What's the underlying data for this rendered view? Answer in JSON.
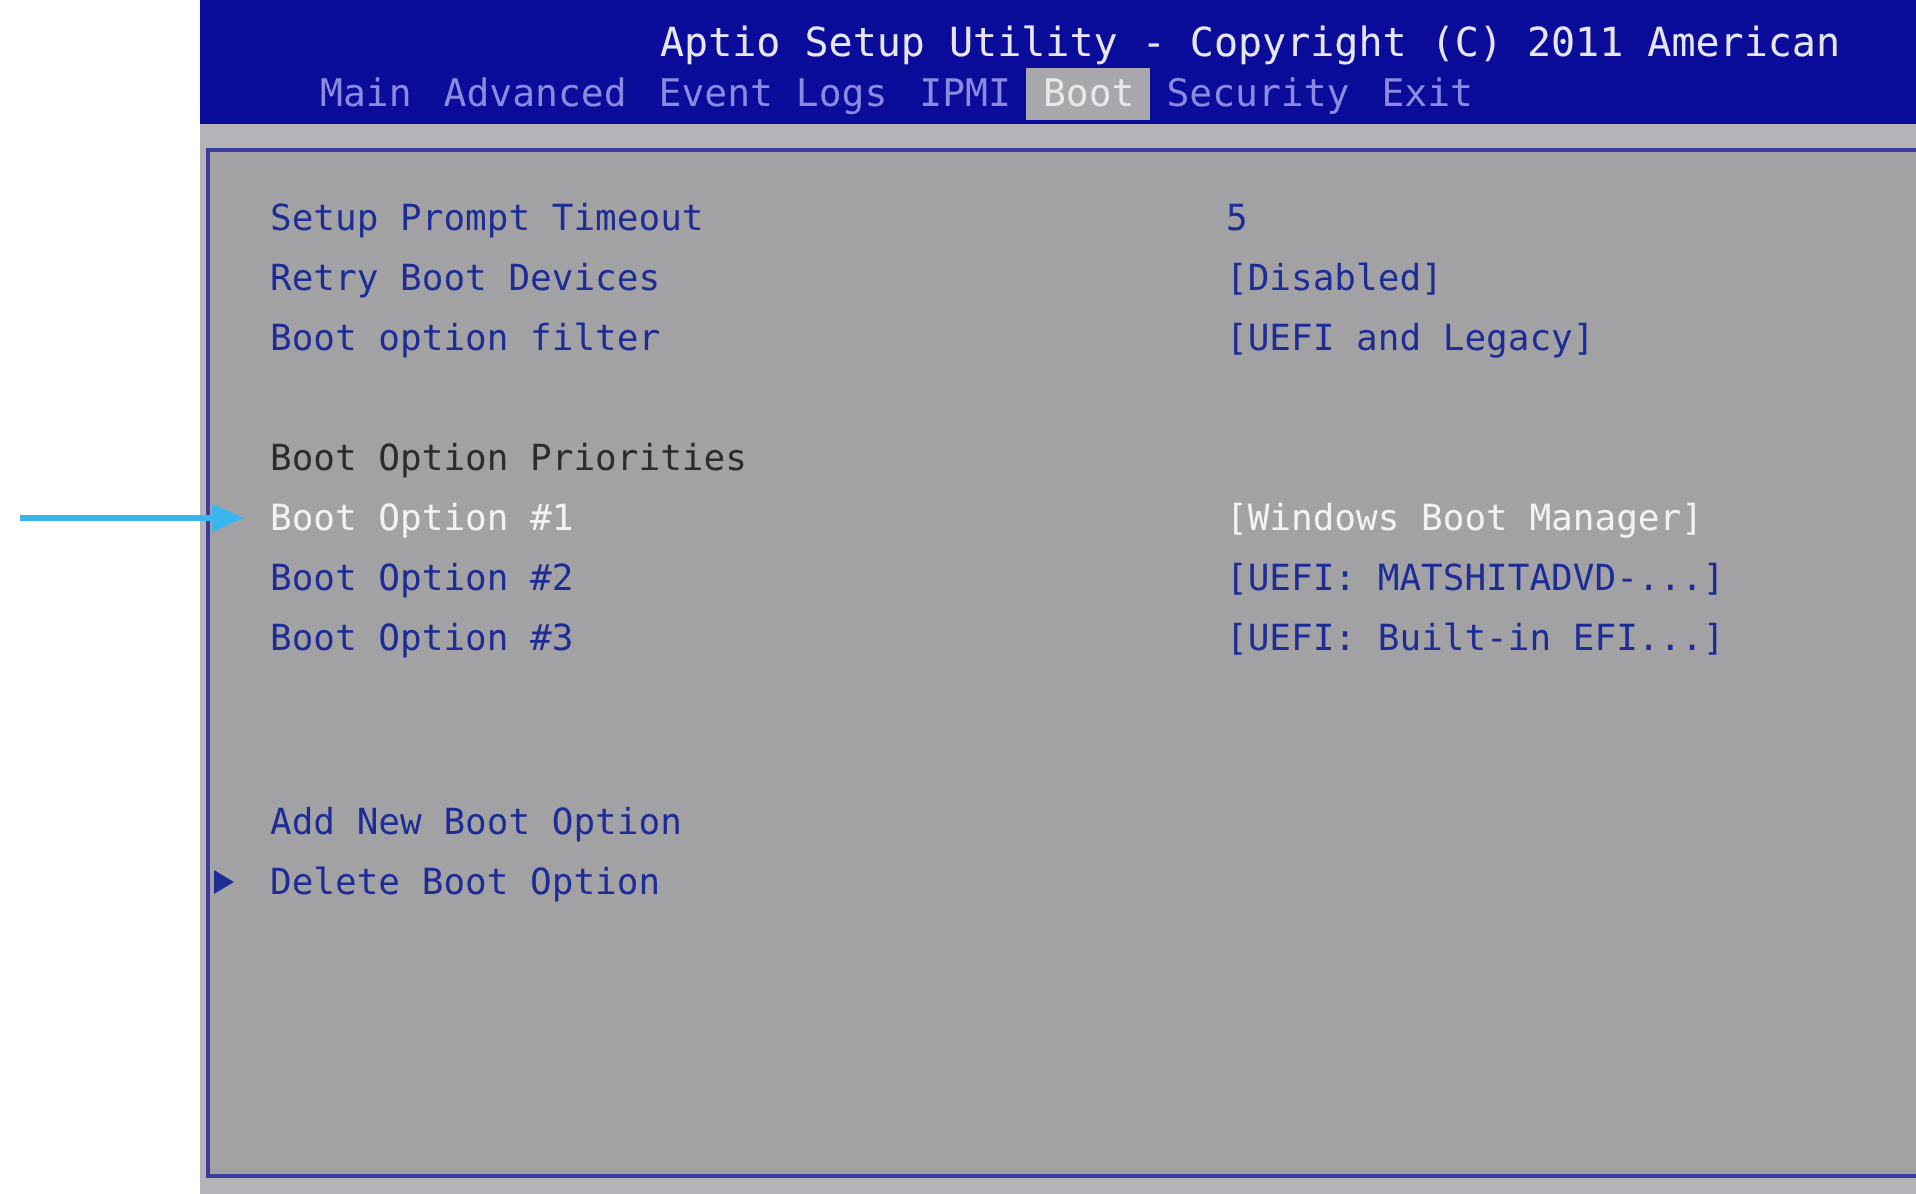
{
  "window": {
    "title": "Aptio Setup Utility - Copyright (C) 2011 American"
  },
  "tabs": [
    {
      "label": "Main",
      "selected": false
    },
    {
      "label": "Advanced",
      "selected": false
    },
    {
      "label": "Event Logs",
      "selected": false
    },
    {
      "label": "IPMI",
      "selected": false
    },
    {
      "label": "Boot",
      "selected": true
    },
    {
      "label": "Security",
      "selected": false
    },
    {
      "label": "Exit",
      "selected": false
    }
  ],
  "groups": [
    {
      "rows": [
        {
          "kind": "item",
          "label": "Setup Prompt Timeout",
          "value": "5",
          "selected": false,
          "submenu": false
        },
        {
          "kind": "item",
          "label": "Retry Boot Devices",
          "value": "[Disabled]",
          "selected": false,
          "submenu": false
        },
        {
          "kind": "item",
          "label": "Boot option filter",
          "value": "[UEFI and Legacy]",
          "selected": false,
          "submenu": false
        }
      ]
    },
    {
      "rows": [
        {
          "kind": "heading",
          "label": "Boot Option Priorities"
        },
        {
          "kind": "item",
          "label": "Boot Option #1",
          "value": "[Windows Boot Manager]",
          "selected": true,
          "submenu": false,
          "pointed": true
        },
        {
          "kind": "item",
          "label": "Boot Option #2",
          "value": "[UEFI: MATSHITADVD-...]",
          "selected": false,
          "submenu": false
        },
        {
          "kind": "item",
          "label": "Boot Option #3",
          "value": "[UEFI: Built-in EFI...]",
          "selected": false,
          "submenu": false
        }
      ]
    },
    {
      "rows": [
        {
          "kind": "item",
          "label": "Add New Boot Option",
          "selected": false,
          "submenu": false
        },
        {
          "kind": "item",
          "label": "Delete Boot Option",
          "selected": false,
          "submenu": true
        }
      ]
    }
  ]
}
